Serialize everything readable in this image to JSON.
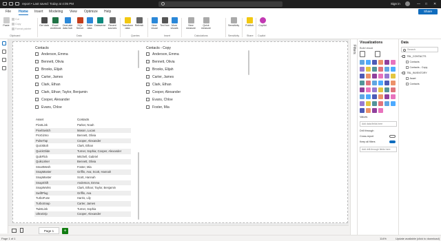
{
  "titlebar": {
    "document": "report • Last saved: Today at 4:05 PM",
    "search_placeholder": "",
    "signin": "Sign in",
    "minimize": "—",
    "maximize": "□",
    "close": "✕"
  },
  "tabs": [
    "File",
    "Home",
    "Insert",
    "Modeling",
    "View",
    "Optimize",
    "Help"
  ],
  "share": "Share",
  "ribbon": {
    "clipboard_items": [
      "Paste",
      "Cut",
      "Copy",
      "Format painter"
    ],
    "buttons": [
      {
        "label": "Get data",
        "icon": "database-icon",
        "color": "#4a4a4a"
      },
      {
        "label": "Excel workbook",
        "icon": "excel-icon",
        "color": "#217346"
      },
      {
        "label": "OneLake data hub",
        "icon": "onelake-icon",
        "color": "#2b88d8"
      },
      {
        "label": "SQL Server",
        "icon": "sql-server-icon",
        "color": "#c43e1c"
      },
      {
        "label": "Enter data",
        "icon": "table-icon",
        "color": "#2b88d8"
      },
      {
        "label": "Dataverse",
        "icon": "dataverse-icon",
        "color": "#0e8a7e"
      },
      {
        "label": "Recent sources",
        "icon": "recent-icon",
        "color": "#666666"
      },
      {
        "label": "Transform data",
        "icon": "transform-icon",
        "color": "#f2c811"
      },
      {
        "label": "Refresh",
        "icon": "refresh-icon",
        "color": "#666666"
      },
      {
        "label": "New visual",
        "icon": "new-visual-icon",
        "color": "#2b88d8"
      },
      {
        "label": "Text box",
        "icon": "text-box-icon",
        "color": "#555555"
      },
      {
        "label": "More visuals",
        "icon": "more-visuals-icon",
        "color": "#2b88d8"
      },
      {
        "label": "New measure",
        "icon": "new-measure-icon",
        "color": "#aaaaaa"
      },
      {
        "label": "Quick measure",
        "icon": "quick-measure-icon",
        "color": "#aaaaaa"
      },
      {
        "label": "Sensitivity",
        "icon": "sensitivity-icon",
        "color": "#aaaaaa"
      },
      {
        "label": "Publish",
        "icon": "publish-icon",
        "color": "#f2c811"
      },
      {
        "label": "Copilot",
        "icon": "copilot-icon",
        "color": "#c239b3"
      }
    ],
    "groups": [
      "Clipboard",
      "Data",
      "Queries",
      "Insert",
      "Calculations",
      "Sensitivity",
      "Share",
      "Copilot"
    ]
  },
  "slicer1": {
    "title": "Contacts",
    "items": [
      "Anderson, Emma",
      "Bennett, Olivia",
      "Brooks, Elijah",
      "Carter, James",
      "Clark, Ethan",
      "Clark, Ethan; Taylor, Benjamin",
      "Cooper, Alexander",
      "Evans, Chloe"
    ]
  },
  "slicer2": {
    "title": "Contacts - Copy",
    "items": [
      "Anderson, Emma",
      "Bennett, Olivia",
      "Brooks, Elijah",
      "Carter, James",
      "Clark, Ethan",
      "Cooper, Alexander",
      "Evans, Chloe",
      "Foster, Mia"
    ]
  },
  "table": {
    "headers": [
      "Asset",
      "Contacts"
    ],
    "rows": [
      [
        "PivotLink",
        "Parker, Noah"
      ],
      [
        "PixelSwitch",
        "Mason, Lucas"
      ],
      [
        "ProGizmo",
        "Bennett, Olivia"
      ],
      [
        "PulseTap",
        "Cooper, Alexander"
      ],
      [
        "QuickBolt",
        "Clark, Ethan"
      ],
      [
        "QuickGlide",
        "Turner, Sophia; Cooper, Alexander"
      ],
      [
        "QuikFlick",
        "Mitchell, Gabriel"
      ],
      [
        "QuikLinker",
        "Bennett, Olivia"
      ],
      [
        "SmartMesh",
        "Foster, Mia"
      ],
      [
        "SnapMaster",
        "Griffin, Ava; Scott, Hannah"
      ],
      [
        "SnapMaster",
        "Scott, Hannah"
      ],
      [
        "SnapShift",
        "Anderson, Emma"
      ],
      [
        "SnapWorks",
        "Clark, Ethan; Taylor, Benjamin"
      ],
      [
        "SwiftPlug",
        "Griffin, Ava"
      ],
      [
        "TurboFuse",
        "Harris, Lily"
      ],
      [
        "TurboSnap",
        "Carter, James"
      ],
      [
        "TwistLink",
        "Turner, Sophia"
      ],
      [
        "UltraGrip",
        "Cooper, Alexander"
      ]
    ]
  },
  "pagebar": {
    "page": "Page 1",
    "add": "+"
  },
  "status": {
    "left": "Page 1 of 1",
    "zoom": "114%",
    "right": "Update available (click to download)"
  },
  "filters": {
    "label": "Filters"
  },
  "visualizations": {
    "title": "Visualizations",
    "subtitle": "Build visual",
    "values_label": "Values",
    "values_placeholder": "Add data fields here",
    "drill_label": "Drill through",
    "cross_report": "Cross-report",
    "keep_filters": "Keep all filters",
    "drill_placeholder": "Add drill-through fields here"
  },
  "data_pane": {
    "title": "Data",
    "search_placeholder": "Search",
    "tables": [
      {
        "name": "TBL_CONTACTS",
        "fields": [
          "Contacts",
          "Contacts - Copy"
        ]
      },
      {
        "name": "TBL_INVENTORY",
        "fields": [
          "Asset",
          "Contacts"
        ]
      }
    ]
  },
  "colors": {
    "accent": "#0f6cbd",
    "add_page": "#107c10",
    "toggle_on": "#0f6cbd"
  }
}
